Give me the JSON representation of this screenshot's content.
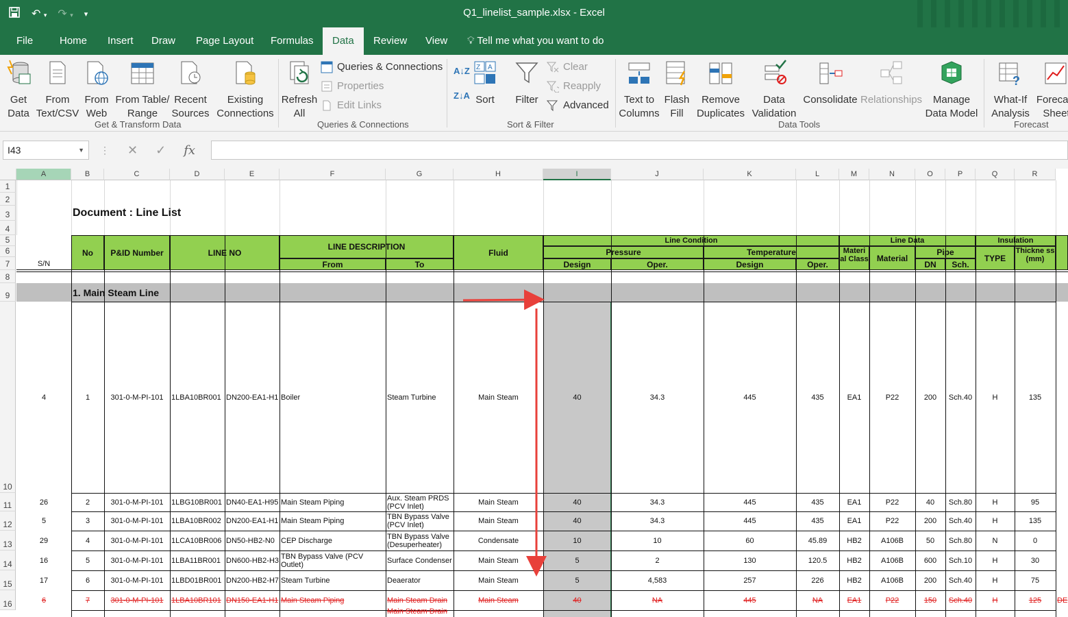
{
  "window": {
    "title": "Q1_linelist_sample.xlsx  -  Excel"
  },
  "tabs": [
    "File",
    "Home",
    "Insert",
    "Draw",
    "Page Layout",
    "Formulas",
    "Data",
    "Review",
    "View"
  ],
  "tell_me": "Tell me what you want to do",
  "ribbon": {
    "get_data": "Get\nData",
    "from_text_csv": "From\nText/CSV",
    "from_web": "From\nWeb",
    "from_table_range": "From Table/\nRange",
    "recent_sources": "Recent\nSources",
    "existing_connections": "Existing\nConnections",
    "group_get_transform": "Get & Transform Data",
    "refresh_all": "Refresh\nAll",
    "queries_connections": "Queries & Connections",
    "properties": "Properties",
    "edit_links": "Edit Links",
    "group_queries": "Queries & Connections",
    "sort": "Sort",
    "filter": "Filter",
    "clear": "Clear",
    "reapply": "Reapply",
    "advanced": "Advanced",
    "group_sort_filter": "Sort & Filter",
    "text_to_columns": "Text to\nColumns",
    "flash_fill": "Flash\nFill",
    "remove_duplicates": "Remove\nDuplicates",
    "data_validation": "Data\nValidation",
    "consolidate": "Consolidate",
    "relationships": "Relationships",
    "manage_data_model": "Manage\nData Model",
    "group_data_tools": "Data Tools",
    "what_if": "What-If\nAnalysis",
    "forecast_sheet": "Forecast\nSheet",
    "group_forecast": "Forecast"
  },
  "formula_bar": {
    "name_box": "I43",
    "formula": ""
  },
  "columns": [
    "A",
    "B",
    "C",
    "D",
    "E",
    "F",
    "G",
    "H",
    "I",
    "J",
    "K",
    "L",
    "M",
    "N",
    "O",
    "P",
    "Q",
    "R"
  ],
  "rows": [
    "1",
    "2",
    "3",
    "4",
    "5",
    "6",
    "7",
    "8",
    "9",
    "10",
    "11",
    "12",
    "13",
    "14",
    "15",
    "16"
  ],
  "doc_title": "Document : Line List",
  "headers": {
    "sn": "S/N",
    "no": "No",
    "pid": "P&ID Number",
    "line_no": "LINE NO",
    "line_desc": "LINE DESCRIPTION",
    "from": "From",
    "to": "To",
    "fluid": "Fluid",
    "line_condition": "Line Condition",
    "pressure": "Pressure",
    "temperature": "Temperature",
    "design_p": "Design",
    "oper_p": "Oper.",
    "design_t": "Design",
    "oper_t": "Oper.",
    "line_data": "Line Data",
    "mat_class": "Materi al Class",
    "material": "Material",
    "pipe": "Pipe",
    "dn": "DN",
    "sch": "Sch.",
    "insulation": "Insulation",
    "type": "TYPE",
    "thickness": "Thickne ss (mm)"
  },
  "section": "1. Main Steam Line",
  "data_rows": [
    [
      "4",
      "1",
      "301-0-M-PI-101",
      "1LBA10BR001",
      "DN200-EA1-H1",
      "Boiler",
      "Steam Turbine",
      "Main Steam",
      "40",
      "34.3",
      "445",
      "435",
      "EA1",
      "P22",
      "200",
      "Sch.40",
      "H",
      "135"
    ],
    [
      "26",
      "2",
      "301-0-M-PI-101",
      "1LBG10BR001",
      "DN40-EA1-H95",
      "Main Steam Piping",
      "Aux. Steam PRDS (PCV Inlet)",
      "Main Steam",
      "40",
      "34.3",
      "445",
      "435",
      "EA1",
      "P22",
      "40",
      "Sch.80",
      "H",
      "95"
    ],
    [
      "5",
      "3",
      "301-0-M-PI-101",
      "1LBA10BR002",
      "DN200-EA1-H1",
      "Main Steam Piping",
      "TBN Bypass Valve (PCV Inlet)",
      "Main Steam",
      "40",
      "34.3",
      "445",
      "435",
      "EA1",
      "P22",
      "200",
      "Sch.40",
      "H",
      "135"
    ],
    [
      "29",
      "4",
      "301-0-M-PI-101",
      "1LCA10BR006",
      "DN50-HB2-N0",
      "CEP Discharge",
      "TBN Bypass Valve (Desuperheater)",
      "Condensate",
      "10",
      "10",
      "60",
      "45.89",
      "HB2",
      "A106B",
      "50",
      "Sch.80",
      "N",
      "0"
    ],
    [
      "16",
      "5",
      "301-0-M-PI-101",
      "1LBA11BR001",
      "DN600-HB2-H3",
      "TBN Bypass Valve (PCV Outlet)",
      "Surface Condenser",
      "Main Steam",
      "5",
      "2",
      "130",
      "120.5",
      "HB2",
      "A106B",
      "600",
      "Sch.10",
      "H",
      "30"
    ],
    [
      "17",
      "6",
      "301-0-M-PI-101",
      "1LBD01BR001",
      "DN200-HB2-H7",
      "Steam Turbine",
      "Deaerator",
      "Main Steam",
      "5",
      "4,583",
      "257",
      "226",
      "HB2",
      "A106B",
      "200",
      "Sch.40",
      "H",
      "75"
    ],
    [
      "6",
      "7",
      "301-0-M-PI-101",
      "1LBA10BR101",
      "DN150-EA1-H1",
      "Main Steam Piping",
      "Main Steam Drain",
      "Main Steam",
      "40",
      "NA",
      "445",
      "NA",
      "EA1",
      "P22",
      "150",
      "Sch.40",
      "H",
      "125"
    ]
  ],
  "row16_extra": "DE",
  "row17_partial": "Main Steam Drain",
  "colors": {
    "excel_green": "#217346",
    "header_green": "#92d050",
    "section_gray": "#bfbfbf",
    "selected_col": "#c8c8c8",
    "annotation_red": "#e8403a",
    "strike_red": "#e01e1e"
  }
}
